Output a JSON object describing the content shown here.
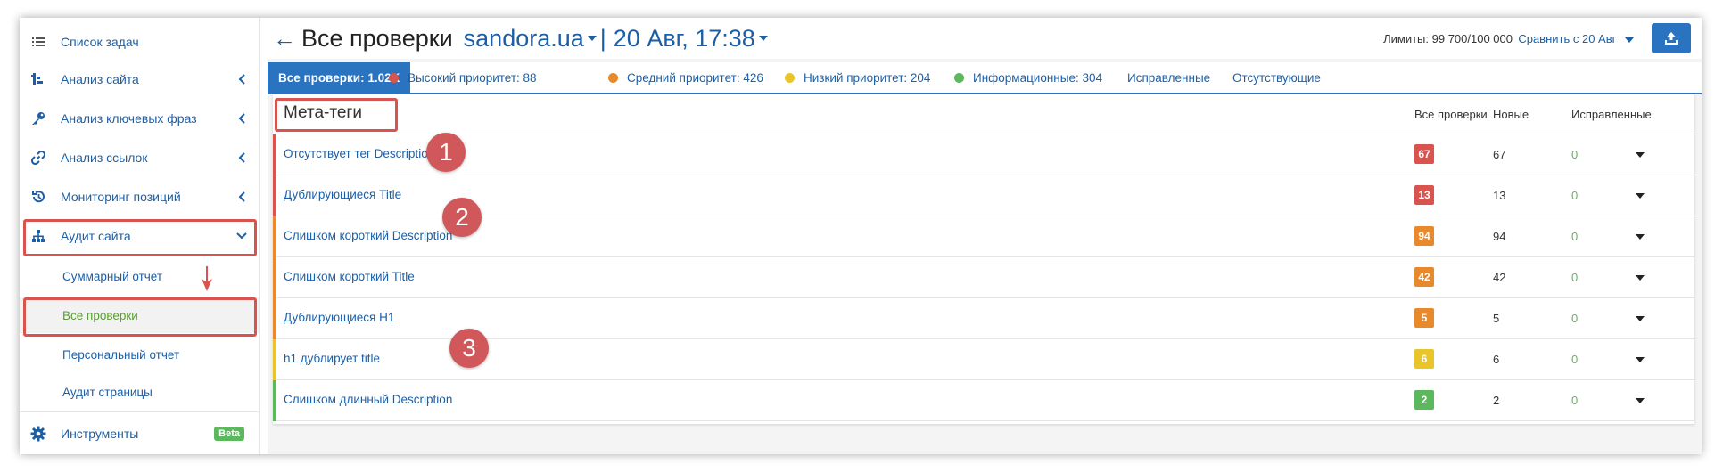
{
  "sidebar": {
    "items": [
      {
        "label": "Список задач",
        "icon": "list-icon"
      },
      {
        "label": "Анализ сайта",
        "icon": "analysis-icon"
      },
      {
        "label": "Анализ ключевых фраз",
        "icon": "key-icon"
      },
      {
        "label": "Анализ ссылок",
        "icon": "link-icon"
      },
      {
        "label": "Мониторинг позиций",
        "icon": "history-icon"
      },
      {
        "label": "Аудит сайта",
        "icon": "sitemap-icon"
      }
    ],
    "sub_items": [
      {
        "label": "Суммарный отчет"
      },
      {
        "label": "Все проверки"
      },
      {
        "label": "Персональный отчет"
      },
      {
        "label": "Аудит страницы"
      }
    ],
    "tools": {
      "label": "Инструменты",
      "badge": "Beta"
    }
  },
  "header": {
    "back": "←",
    "title": "Все проверки",
    "domain": "sandora.ua",
    "separator": "|",
    "date": "20 Авг, 17:38",
    "limits": "Лимиты: 99 700/100 000",
    "compare": "Сравнить с 20 Авг"
  },
  "tabs": [
    {
      "label": "Все проверки: 1.02K"
    },
    {
      "label": "Высокий приоритет: 88",
      "color": "#d9534f"
    },
    {
      "label": "Средний приоритет: 426",
      "color": "#e8892b"
    },
    {
      "label": "Низкий приоритет: 204",
      "color": "#e8c62b"
    },
    {
      "label": "Информационные: 304",
      "color": "#5cb85c"
    },
    {
      "label": "Исправленные"
    },
    {
      "label": "Отсутствующие"
    }
  ],
  "table": {
    "section_title": "Мета-теги",
    "headers": {
      "all": "Все проверки",
      "new": "Новые",
      "fixed": "Исправленные"
    },
    "rows": [
      {
        "name": "Отсутствует тег Description",
        "all": "67",
        "new": "67",
        "fixed": "0",
        "color": "#d9534f"
      },
      {
        "name": "Дублирующиеся Title",
        "all": "13",
        "new": "13",
        "fixed": "0",
        "color": "#d9534f"
      },
      {
        "name": "Слишком короткий Description",
        "all": "94",
        "new": "94",
        "fixed": "0",
        "color": "#e8892b"
      },
      {
        "name": "Слишком короткий Title",
        "all": "42",
        "new": "42",
        "fixed": "0",
        "color": "#e8892b"
      },
      {
        "name": "Дублирующиеся H1",
        "all": "5",
        "new": "5",
        "fixed": "0",
        "color": "#e8892b"
      },
      {
        "name": "h1 дублирует title",
        "all": "6",
        "new": "6",
        "fixed": "0",
        "color": "#e8c62b"
      },
      {
        "name": "Слишком длинный Description",
        "all": "2",
        "new": "2",
        "fixed": "0",
        "color": "#5cb85c"
      }
    ]
  },
  "annotations": [
    "1",
    "2",
    "3"
  ]
}
